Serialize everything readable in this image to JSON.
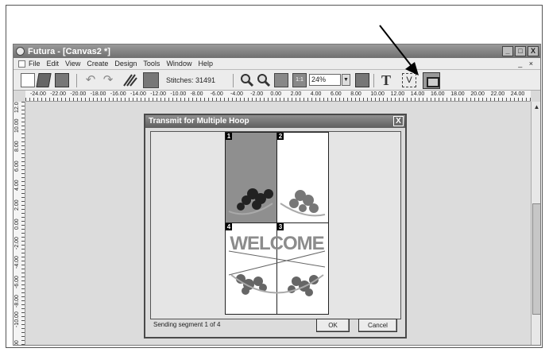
{
  "window": {
    "title": "Futura - [Canvas2 *]",
    "controls": [
      "_",
      "□",
      "X"
    ],
    "doc_controls": "_ ×"
  },
  "menu": {
    "items": [
      "File",
      "Edit",
      "View",
      "Create",
      "Design",
      "Tools",
      "Window",
      "Help"
    ]
  },
  "toolbar": {
    "stitches_label": "Stitches: 31491",
    "zoom_value": "24%",
    "zoom_arrow": "▼",
    "one_to_one": "1:1",
    "undo_glyph": "↶",
    "redo_glyph": "↷",
    "text_tool_glyph": "T",
    "select_tool_glyph": "V",
    "icons": [
      "new-file-icon",
      "open-file-icon",
      "save-icon",
      "undo-icon",
      "redo-icon",
      "stitch-icon",
      "color-swatch-icon",
      "zoom-in-icon",
      "zoom-out-icon",
      "zoom-fit-icon",
      "zoom-1to1-icon",
      "monitor-icon",
      "text-tool-icon",
      "select-tool-icon",
      "transmit-icon"
    ]
  },
  "ruler": {
    "horizontal": [
      "-24.00",
      "-22.00",
      "-20.00",
      "-18.00",
      "-16.00",
      "-14.00",
      "-12.00",
      "-10.00",
      "-8.00",
      "-6.00",
      "-4.00",
      "-2.00",
      "0.00",
      "2.00",
      "4.00",
      "6.00",
      "8.00",
      "10.00",
      "12.00",
      "14.00",
      "16.00",
      "18.00",
      "20.00",
      "22.00",
      "24.00"
    ],
    "vertical": [
      "12.0",
      "10.00",
      "8.00",
      "6.00",
      "4.00",
      "2.00",
      "0.00",
      "-2.00",
      "-4.00",
      "-6.00",
      "-8.00",
      "-10.00",
      "00"
    ]
  },
  "dialog": {
    "title": "Transmit for Multiple Hoop",
    "close": "X",
    "segments": [
      "1",
      "2",
      "3",
      "4"
    ],
    "design_text": "WELCOME",
    "status": "Sending segment 1 of 4",
    "ok_label": "OK",
    "cancel_label": "Cancel"
  },
  "scrollbar": {
    "up_arrow": "▲"
  },
  "colors": {
    "title_bar": "#7a7a7a",
    "highlight_segment": "#8f8f8f",
    "background": "#dcdcdc"
  }
}
